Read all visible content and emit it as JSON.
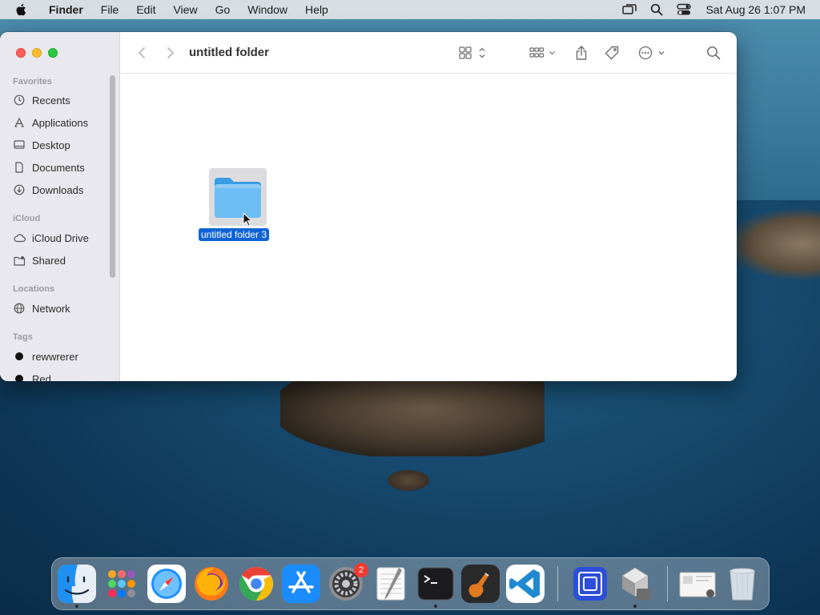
{
  "menubar": {
    "app_name": "Finder",
    "items": [
      "File",
      "Edit",
      "View",
      "Go",
      "Window",
      "Help"
    ],
    "clock": "Sat Aug 26  1:07 PM"
  },
  "window": {
    "title": "untitled folder"
  },
  "sidebar": {
    "sections": {
      "favorites": "Favorites",
      "icloud": "iCloud",
      "locations": "Locations",
      "tags": "Tags"
    },
    "favorites": [
      "Recents",
      "Applications",
      "Desktop",
      "Documents",
      "Downloads"
    ],
    "icloud": [
      "iCloud Drive",
      "Shared"
    ],
    "locations": [
      "Network"
    ],
    "tags": [
      "rewwrerer",
      "Red"
    ]
  },
  "content": {
    "items": [
      {
        "name": "untitled folder 3",
        "type": "folder",
        "selected": true
      }
    ]
  },
  "dock": {
    "apps": [
      "Finder",
      "Launchpad",
      "Safari",
      "Firefox",
      "Chrome",
      "App Store",
      "System Preferences",
      "TextEdit",
      "Terminal",
      "GarageBand",
      "Visual Studio Code",
      "Remote Desktop",
      "Installer",
      "Preview",
      "Trash"
    ],
    "system_prefs_badge": "2"
  },
  "colors": {
    "accent": "#1063d6",
    "close": "#fe5f57",
    "minimize": "#febc2e",
    "zoom": "#28c840",
    "folder": "#5fb3ee"
  }
}
